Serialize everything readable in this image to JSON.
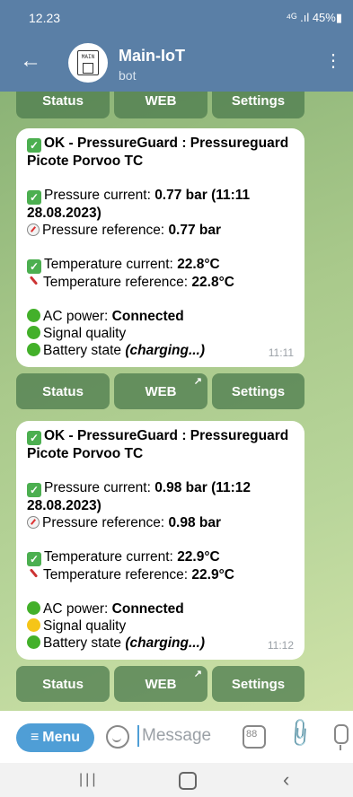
{
  "status_bar": {
    "time": "12.23",
    "system": "⁴ᴳ .ıl 45%▮"
  },
  "app_bar": {
    "title": "Main-IoT",
    "subtitle": "bot",
    "logo_text": "MAIN"
  },
  "keyboard_labels": {
    "status": "Status",
    "web": "WEB",
    "settings": "Settings",
    "external_icon": "↗"
  },
  "messages": [
    {
      "header": "OK - PressureGuard : Pressureguard Picote Porvoo TC",
      "pressure_current_label": "Pressure current: ",
      "pressure_current_value": "0.77 bar (11:11 28.08.2023)",
      "pressure_reference_label": "Pressure reference: ",
      "pressure_reference_value": "0.77 bar",
      "temperature_current_label": "Temperature current: ",
      "temperature_current_value": "22.8°C",
      "temperature_reference_label": "Temperature reference: ",
      "temperature_reference_value": "22.8°C",
      "ac_power_label": "AC power: ",
      "ac_power_value": "Connected",
      "signal_label": "Signal quality",
      "signal_color": "#43b02a",
      "battery_label": "Battery state ",
      "battery_value": "(charging...)",
      "time": "11:11"
    },
    {
      "header": "OK - PressureGuard : Pressureguard Picote Porvoo TC",
      "pressure_current_label": "Pressure current: ",
      "pressure_current_value": "0.98 bar (11:12 28.08.2023)",
      "pressure_reference_label": "Pressure reference: ",
      "pressure_reference_value": "0.98 bar",
      "temperature_current_label": "Temperature current: ",
      "temperature_current_value": "22.9°C",
      "temperature_reference_label": "Temperature reference: ",
      "temperature_reference_value": "22.9°C",
      "ac_power_label": "AC power: ",
      "ac_power_value": "Connected",
      "signal_label": "Signal quality",
      "signal_color": "#f5c518",
      "battery_label": "Battery state ",
      "battery_value": "(charging...)",
      "time": "11:12"
    }
  ],
  "composer": {
    "menu_label": "Menu",
    "menu_icon": "≡",
    "placeholder": "Message"
  },
  "colors": {
    "green_status": "#43b02a",
    "accent": "#4f9ed6",
    "header": "#5a7fa6"
  }
}
